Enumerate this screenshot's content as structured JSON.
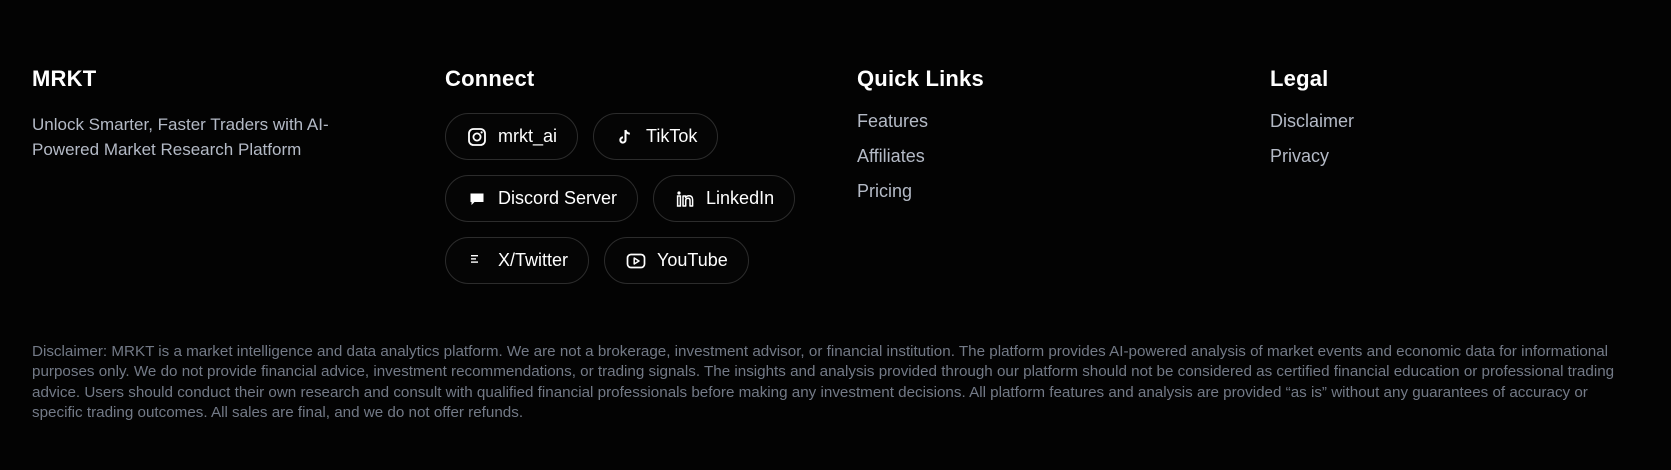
{
  "brand": {
    "title": "MRKT",
    "tagline": "Unlock Smarter, Faster Traders with AI-Powered Market Research Platform"
  },
  "connect": {
    "title": "Connect",
    "rows": [
      [
        {
          "label": "mrkt_ai",
          "icon": "instagram-icon"
        },
        {
          "label": "TikTok",
          "icon": "tiktok-icon"
        }
      ],
      [
        {
          "label": "Discord Server",
          "icon": "discord-icon"
        },
        {
          "label": "LinkedIn",
          "icon": "linkedin-icon"
        }
      ],
      [
        {
          "label": "X/Twitter",
          "icon": "x-twitter-icon"
        },
        {
          "label": "YouTube",
          "icon": "youtube-icon"
        }
      ]
    ]
  },
  "quick_links": {
    "title": "Quick Links",
    "items": [
      "Features",
      "Affiliates",
      "Pricing"
    ]
  },
  "legal": {
    "title": "Legal",
    "items": [
      "Disclaimer",
      "Privacy"
    ]
  },
  "disclaimer": "Disclaimer: MRKT is a market intelligence and data analytics platform. We are not a brokerage, investment advisor, or financial institution. The platform provides AI-powered analysis of market events and economic data for informational purposes only. We do not provide financial advice, investment recommendations, or trading signals. The insights and analysis provided through our platform should not be considered as certified financial education or professional trading advice. Users should conduct their own research and consult with qualified financial professionals before making any investment decisions. All platform features and analysis are provided “as is” without any guarantees of accuracy or specific trading outcomes. All sales are final, and we do not offer refunds.",
  "colors": {
    "background": "#030303",
    "text_primary": "#ffffff",
    "text_secondary": "#b4bac6",
    "text_muted": "#737a87",
    "pill_border": "#2c2c2c"
  }
}
